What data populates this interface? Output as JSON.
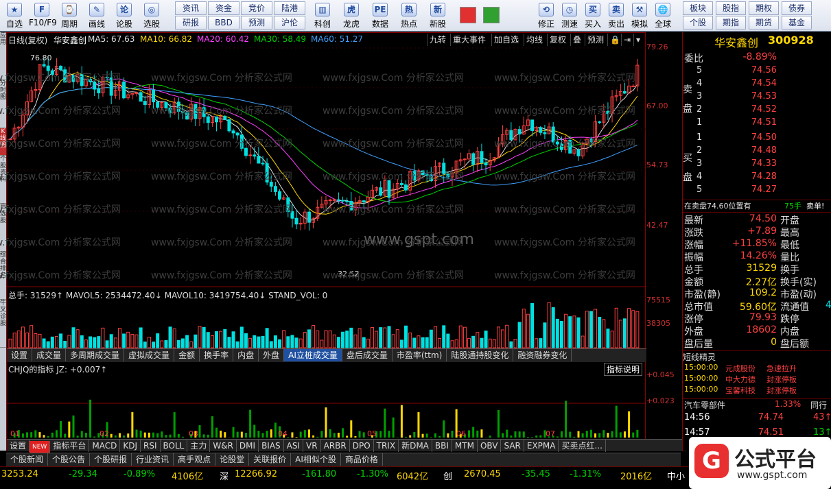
{
  "toolbar": [
    {
      "label": "自选",
      "icon": "★"
    },
    {
      "label": "F10/F9",
      "icon": "F"
    },
    {
      "label": "周期",
      "icon": "⌚"
    },
    {
      "label": "画线",
      "icon": "✎"
    },
    {
      "label": "论股",
      "icon": "论"
    },
    {
      "label": "选股",
      "icon": "◎"
    }
  ],
  "toolbar_small": [
    [
      "资讯",
      "研报"
    ],
    [
      "资金",
      "BBD"
    ],
    [
      "竞价",
      "预测"
    ],
    [
      "陆港",
      "沪伦"
    ]
  ],
  "toolbar2": [
    {
      "label": "科创",
      "icon": "▥"
    },
    {
      "label": "龙虎",
      "icon": "虎"
    },
    {
      "label": "数据",
      "icon": "PE"
    },
    {
      "label": "热点",
      "icon": "热"
    },
    {
      "label": "新股",
      "icon": "新"
    }
  ],
  "toolbar3": [
    {
      "label": "修正",
      "icon": "⟲"
    },
    {
      "label": "测速",
      "icon": "◷"
    },
    {
      "label": "买入",
      "icon": "买"
    },
    {
      "label": "卖出",
      "icon": "卖"
    },
    {
      "label": "模拟",
      "icon": "⚒"
    },
    {
      "label": "全球",
      "icon": "🌐"
    }
  ],
  "toolbar_right": [
    [
      "板块",
      "个股"
    ],
    [
      "股指",
      "期指"
    ],
    [
      "期权",
      "期货"
    ],
    [
      "债券",
      "基金"
    ]
  ],
  "left_tabs": [
    "应用",
    "分时图",
    "K线图",
    "个股资料",
    "自选股",
    "综合排名",
    "牛叉诊股"
  ],
  "chart": {
    "title": "日线(复权)",
    "stock": "华安鑫创",
    "ma": [
      {
        "label": "MA5: 67.63",
        "color": "#e0e0e0"
      },
      {
        "label": "MA10: 66.82",
        "color": "#ffd800"
      },
      {
        "label": "MA20: 60.42",
        "color": "#ff40ff"
      },
      {
        "label": "MA30: 58.49",
        "color": "#00d000"
      },
      {
        "label": "MA60: 51.27",
        "color": "#40a0ff"
      }
    ],
    "buttons": [
      "九转",
      "重大事件",
      "加自选",
      "均线",
      "复权",
      "叠",
      "预测"
    ],
    "yaxis": [
      "79.26",
      "67.00",
      "54.73",
      "42.47"
    ],
    "high_label": "76.80",
    "low_label": "32.52",
    "site": "www.gspt.com",
    "watermark": "www.fxjgsw.Com 分析家公式网",
    "vol_header": "总手: 31529↑ MAVOL5: 2534472.40↓ MAVOL10: 3419754.40↓ STAND_VOL: 0",
    "vol_axis": [
      "75515",
      "38305"
    ],
    "tabs1": [
      "设置",
      "成交量",
      "多周期成交量",
      "虚拟成交量",
      "金额",
      "换手率",
      "内盘",
      "外盘",
      "AI立桩成交量",
      "盘后成交量",
      "市盈率(ttm)",
      "陆股通持股变化",
      "融资融券变化"
    ],
    "ind_header": "CHJQ的指标 JZ: +0.007↑",
    "ind_btn": "指标说明",
    "ind_axis": [
      "+0.045",
      "+0.023"
    ],
    "months": [
      "01",
      "02",
      "03",
      "04",
      "05",
      "06",
      "07"
    ],
    "tabs2": [
      "设置",
      "NEW",
      "指标平台",
      "MACD",
      "KDJ",
      "RSI",
      "BOLL",
      "主力",
      "W&R",
      "DMI",
      "BIAS",
      "ASI",
      "VR",
      "ARBR",
      "DPO",
      "TRIX",
      "新DMA",
      "BBI",
      "MTM",
      "OBV",
      "SAR",
      "EXPMA",
      "买卖点红..."
    ],
    "tabs3": [
      "个股新闻",
      "个股公告",
      "个股研报",
      "行业资讯",
      "高手观点",
      "论股堂",
      "关联报价",
      "AI相似个股",
      "商品价格"
    ]
  },
  "quote": {
    "name": "华安鑫创",
    "code": "300928",
    "weibi_label": "委比",
    "weibi": "-8.89%",
    "sell_label": "卖盘",
    "buy_label": "买盘",
    "sell": [
      [
        "5",
        "74.56"
      ],
      [
        "4",
        "74.54"
      ],
      [
        "3",
        "74.53"
      ],
      [
        "2",
        "74.52"
      ],
      [
        "1",
        "74.51"
      ]
    ],
    "buy": [
      [
        "1",
        "74.50"
      ],
      [
        "2",
        "74.48"
      ],
      [
        "3",
        "74.33"
      ],
      [
        "4",
        "74.28"
      ],
      [
        "5",
        "74.27"
      ]
    ],
    "info": "在卖盘74.60位置有",
    "info_qty": "75手",
    "info_tag": "卖单!",
    "stats": [
      [
        "最新",
        "74.50",
        "开盘",
        ""
      ],
      [
        "涨跌",
        "+7.89",
        "最高",
        ""
      ],
      [
        "涨幅",
        "+11.85%",
        "最低",
        ""
      ],
      [
        "振幅",
        "14.26%",
        "量比",
        ""
      ],
      [
        "总手",
        "31529",
        "换手",
        ""
      ],
      [
        "金额",
        "2.27亿",
        "换手(实)",
        ""
      ],
      [
        "市盈(静)",
        "109.2",
        "市盈(动)",
        ""
      ],
      [
        "总市值",
        "59.60亿",
        "流通值",
        "4"
      ],
      [
        "涨停",
        "79.93",
        "跌停",
        ""
      ],
      [
        "外盘",
        "18602",
        "内盘",
        ""
      ],
      [
        "盘后量",
        "0",
        "盘后额",
        ""
      ]
    ],
    "ling_title": "短线精灵",
    "ling": [
      [
        "15:00:00",
        "元成股份",
        "急速拉升"
      ],
      [
        "15:00:00",
        "中大力德",
        "封涨停板"
      ],
      [
        "15:00:00",
        "宝馨科技",
        "封涨停板"
      ]
    ],
    "sector": "汽车零部件",
    "sector_pct": "1.33%",
    "sector_btn": "同行",
    "ticks": [
      [
        "14:56",
        "74.74",
        "43"
      ],
      [
        "14:57",
        "74.51",
        "13"
      ]
    ]
  },
  "status": {
    "sh": "3253.24",
    "sh_chg": "-29.34",
    "sh_pct": "-0.89%",
    "sh_amt": "4106亿",
    "sz_label": "深",
    "sz": "12266.92",
    "sz_chg": "-161.80",
    "sz_pct": "-1.30%",
    "sz_amt": "6042亿",
    "cy_label": "创",
    "cy": "2670.45",
    "cy_chg": "-35.45",
    "cy_pct": "-1.31%",
    "cy_amt": "2016亿",
    "more": "中小",
    "brand": "公式平台",
    "brand_url": "www.gspt.com"
  }
}
